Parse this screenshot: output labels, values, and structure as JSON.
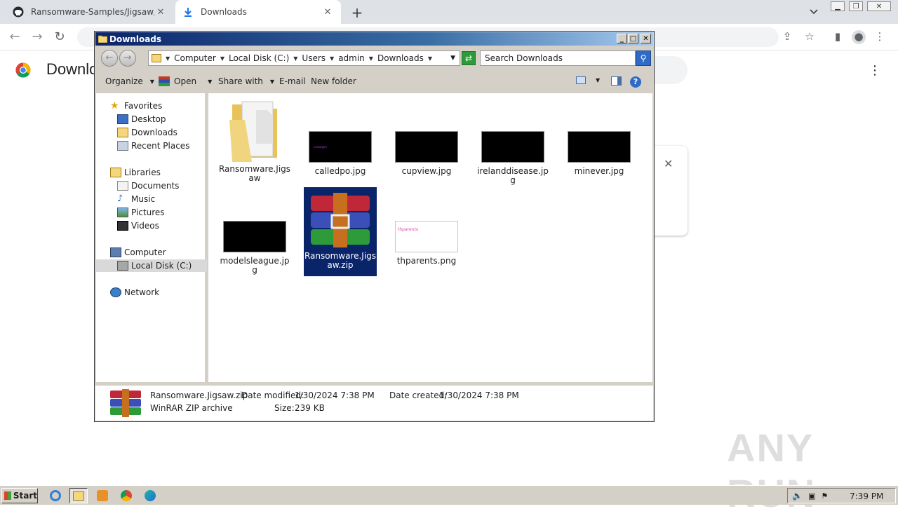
{
  "chrome": {
    "tabs": [
      {
        "title": "Ransomware-Samples/Jigsaw/Ransom",
        "icon": "github-icon"
      },
      {
        "title": "Downloads",
        "icon": "download-icon"
      }
    ],
    "new_tab": "+",
    "page_title": "Downloads",
    "accent": "#1a73e8"
  },
  "explorer": {
    "title": "Downloads",
    "breadcrumbs": [
      "Computer",
      "Local Disk (C:)",
      "Users",
      "admin",
      "Downloads"
    ],
    "search_placeholder": "Search Downloads",
    "toolbar": {
      "organize": "Organize",
      "open": "Open",
      "share_with": "Share with",
      "email": "E-mail",
      "new_folder": "New folder"
    },
    "nav": {
      "favorites": "Favorites",
      "desktop": "Desktop",
      "downloads": "Downloads",
      "recent": "Recent Places",
      "libraries": "Libraries",
      "documents": "Documents",
      "music": "Music",
      "pictures": "Pictures",
      "videos": "Videos",
      "computer": "Computer",
      "local_disk": "Local Disk (C:)",
      "network": "Network"
    },
    "files": [
      {
        "name": "Ransomware.Jigsaw",
        "type": "folder"
      },
      {
        "name": "calledpo.jpg",
        "type": "image-dark"
      },
      {
        "name": "cupview.jpg",
        "type": "image-dark"
      },
      {
        "name": "irelanddisease.jpg",
        "type": "image-dark"
      },
      {
        "name": "minever.jpg",
        "type": "image-dark"
      },
      {
        "name": "modelsleague.jpg",
        "type": "image-dark"
      },
      {
        "name": "Ransomware.Jigsaw.zip",
        "type": "winrar",
        "selected": true
      },
      {
        "name": "thparents.png",
        "type": "image-light"
      }
    ],
    "thumb_texts": {
      "calledpo": "ceckogen",
      "thparents": "thparents"
    },
    "status": {
      "name": "Ransomware.Jigsaw.zip",
      "type": "WinRAR ZIP archive",
      "date_modified_label": "Date modified:",
      "date_modified": "1/30/2024 7:38 PM",
      "date_created_label": "Date created:",
      "date_created": "1/30/2024 7:38 PM",
      "size_label": "Size:",
      "size": "239 KB"
    }
  },
  "taskbar": {
    "start": "Start",
    "clock": "7:39 PM"
  },
  "watermark": "ANY RUN"
}
